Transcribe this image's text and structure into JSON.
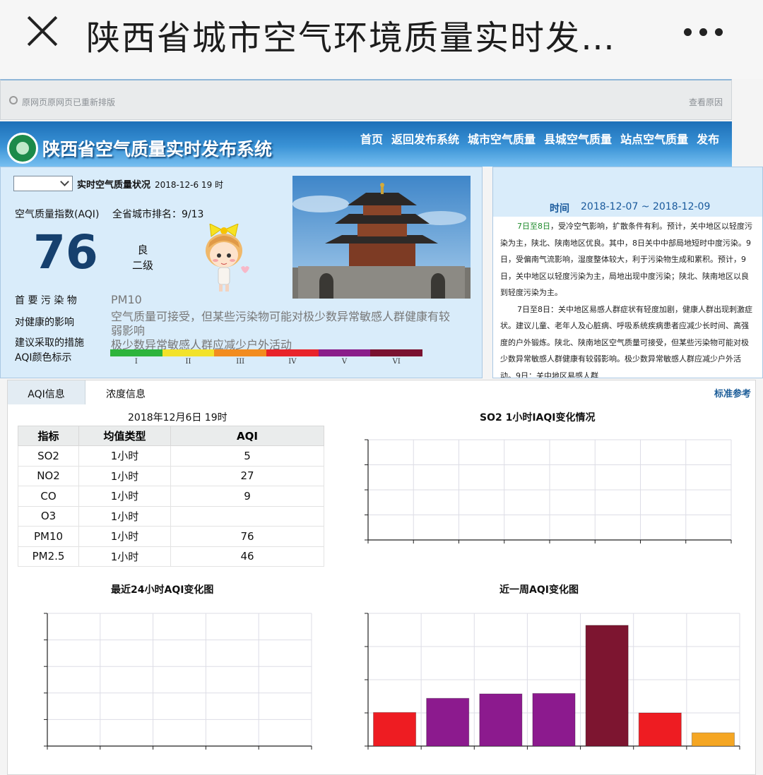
{
  "top_bar": {
    "title": "陕西省城市空气环境质量实时发…"
  },
  "notice": {
    "left": "原网页原网页已重新排版",
    "right": "查看原因"
  },
  "site": {
    "title": "陕西省空气质量实时发布系统"
  },
  "nav": [
    "首页",
    "返回发布系统",
    "城市空气质量",
    "县城空气质量",
    "站点空气质量",
    "发布"
  ],
  "realtime": {
    "status_label": "实时空气质量状况",
    "datetime": "2018-12-6 19 时",
    "aqi_label": "空气质量指数(AQI)",
    "rank_label": "全省城市排名：9/13",
    "aqi_value": "76",
    "quality": "良",
    "level": "二级",
    "primary_pollutant_label": "首 要 污 染 物",
    "primary_pollutant": "PM10",
    "health_label": "对健康的影响",
    "health_text": "空气质量可接受，但某些污染物可能对极少数异常敏感人群健康有较",
    "health_text2": "弱影响",
    "measure_label": "建议采取的措施",
    "measure_text": "极少数异常敏感人群应减少户外活动",
    "color_label": "AQI颜色标示",
    "scale_colors": [
      "#2db43c",
      "#f2e22a",
      "#f28c1f",
      "#e8232a",
      "#8a1d8a",
      "#7a1230"
    ],
    "scale_labels": [
      "I",
      "II",
      "III",
      "IV",
      "V",
      "VI"
    ]
  },
  "forecast": {
    "time_label": "时间",
    "range": "2018-12-07 ~ 2018-12-09",
    "p1_lead": "7日至8日",
    "p1": "，受冷空气影响，扩散条件有利。预计，关中地区以轻度污染为主，陕北、陕南地区优良。其中，8日关中中部局地短时中度污染。9日，受偏南气流影响，湿度整体较大，利于污染物生成和累积。预计，9日，关中地区以轻度污染为主，局地出现中度污染；陕北、陕南地区以良到轻度污染为主。",
    "p2": "7日至8日：关中地区易感人群症状有轻度加剧，健康人群出现刺激症状。建议儿童、老年人及心脏病、呼吸系统疾病患者应减少长时间、高强度的户外锻炼。陕北、陕南地区空气质量可接受，但某些污染物可能对极少数异常敏感人群健康有较弱影响。极少数异常敏感人群应减少户外活动。9日：关中地区易感人群"
  },
  "tabs": {
    "active": "AQI信息",
    "second": "浓度信息",
    "ref": "标准参考"
  },
  "table": {
    "title": "2018年12月6日 19时",
    "headers": [
      "指标",
      "均值类型",
      "AQI"
    ],
    "rows": [
      [
        "SO2",
        "1小时",
        "5"
      ],
      [
        "NO2",
        "1小时",
        "27"
      ],
      [
        "CO",
        "1小时",
        "9"
      ],
      [
        "O3",
        "1小时",
        ""
      ],
      [
        "PM10",
        "1小时",
        "76"
      ],
      [
        "PM2.5",
        "1小时",
        "46"
      ]
    ]
  },
  "charts": {
    "so2_title": "SO2  1小时IAQI变化情况",
    "h24_title": "最近24小时AQI变化图",
    "week_title": "近一周AQI变化图"
  },
  "chart_data": [
    {
      "type": "line",
      "title": "SO2  1小时IAQI变化情况",
      "series": []
    },
    {
      "type": "line",
      "title": "最近24小时AQI变化图",
      "series": []
    },
    {
      "type": "bar",
      "title": "近一周AQI变化图",
      "values": [
        76,
        108,
        118,
        119,
        273,
        75,
        30
      ],
      "colors": [
        "#ee1c22",
        "#8c1a8e",
        "#8c1a8e",
        "#8c1a8e",
        "#7d1530",
        "#ee1c22",
        "#f5a623"
      ],
      "ylim": [
        0,
        300
      ]
    }
  ]
}
